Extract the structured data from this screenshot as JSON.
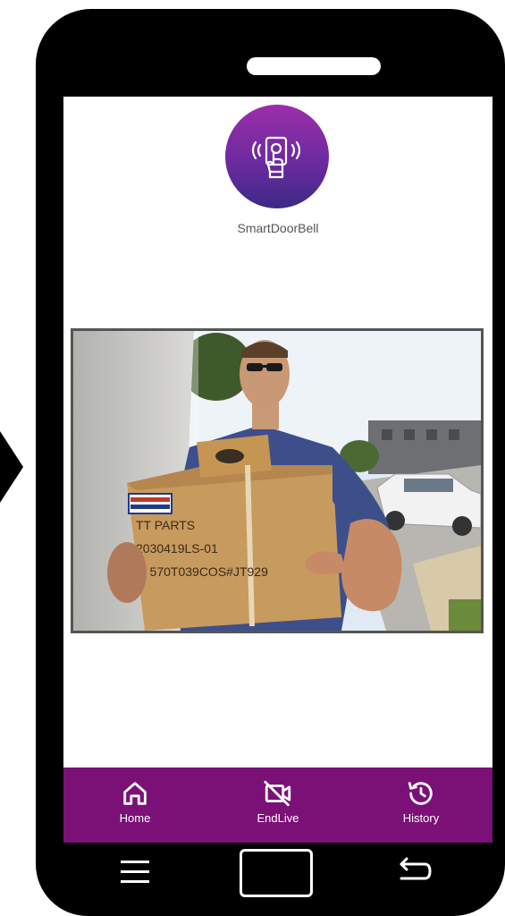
{
  "app": {
    "name": "SmartDoorBell",
    "logo_icon": "hand-tap-phone-icon"
  },
  "live_view": {
    "description_icon": "doorbell-camera-feed",
    "box_text": [
      "TT PARTS",
      "2030419LS-01",
      "M 570T039COS#JT929"
    ]
  },
  "bottom_nav": {
    "items": [
      {
        "label": "Home",
        "icon": "home-icon"
      },
      {
        "label": "EndLive",
        "icon": "video-off-icon"
      },
      {
        "label": "History",
        "icon": "history-icon"
      }
    ]
  },
  "system_nav": {
    "menu_icon": "menu-icon",
    "home_icon": "home-square-icon",
    "back_icon": "back-icon"
  },
  "colors": {
    "nav_background": "#7b1176",
    "logo_gradient_top": "#9b2ea8",
    "logo_gradient_bottom": "#3b2a86",
    "phone_body": "#000000"
  }
}
